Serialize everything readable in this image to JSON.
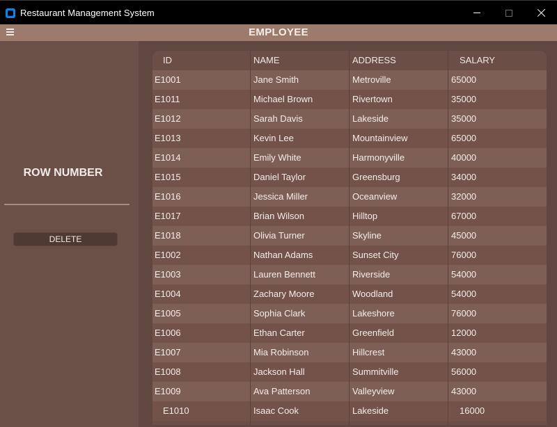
{
  "window": {
    "title": "Restaurant Management System"
  },
  "header": {
    "title": "EMPLOYEE"
  },
  "sidebar": {
    "row_number_label": "ROW NUMBER",
    "row_number_value": "",
    "delete_label": "DELETE"
  },
  "table": {
    "columns": [
      "ID",
      "NAME",
      "ADDRESS",
      "SALARY"
    ],
    "rows": [
      [
        "E1001",
        "Jane Smith",
        "Metroville",
        "65000"
      ],
      [
        "E1011",
        "Michael Brown",
        "Rivertown",
        "35000"
      ],
      [
        "E1012",
        "Sarah Davis",
        "Lakeside",
        "35000"
      ],
      [
        "E1013",
        "Kevin Lee",
        "Mountainview",
        "65000"
      ],
      [
        "E1014",
        "Emily White",
        "Harmonyville",
        "40000"
      ],
      [
        "E1015",
        "Daniel Taylor",
        "Greensburg",
        "34000"
      ],
      [
        "E1016",
        "Jessica Miller",
        "Oceanview",
        "32000"
      ],
      [
        "E1017",
        "Brian Wilson",
        "Hilltop",
        "67000"
      ],
      [
        "E1018",
        "Olivia Turner",
        "Skyline",
        "45000"
      ],
      [
        "E1002",
        "Nathan Adams",
        "Sunset City",
        "76000"
      ],
      [
        "E1003",
        "Lauren Bennett",
        "Riverside",
        "54000"
      ],
      [
        "E1004",
        "Zachary Moore",
        "Woodland",
        "54000"
      ],
      [
        "E1005",
        "Sophia Clark",
        "Lakeshore",
        "76000"
      ],
      [
        "E1006",
        "Ethan Carter",
        "Greenfield",
        "12000"
      ],
      [
        "E1007",
        "Mia Robinson",
        "Hillcrest",
        "43000"
      ],
      [
        "E1008",
        "Jackson Hall",
        "Summitville",
        "56000"
      ],
      [
        "E1009",
        "Ava Patterson",
        "Valleyview",
        "43000"
      ],
      [
        "E1010",
        "Isaac Cook",
        "Lakeside",
        "16000"
      ]
    ]
  }
}
